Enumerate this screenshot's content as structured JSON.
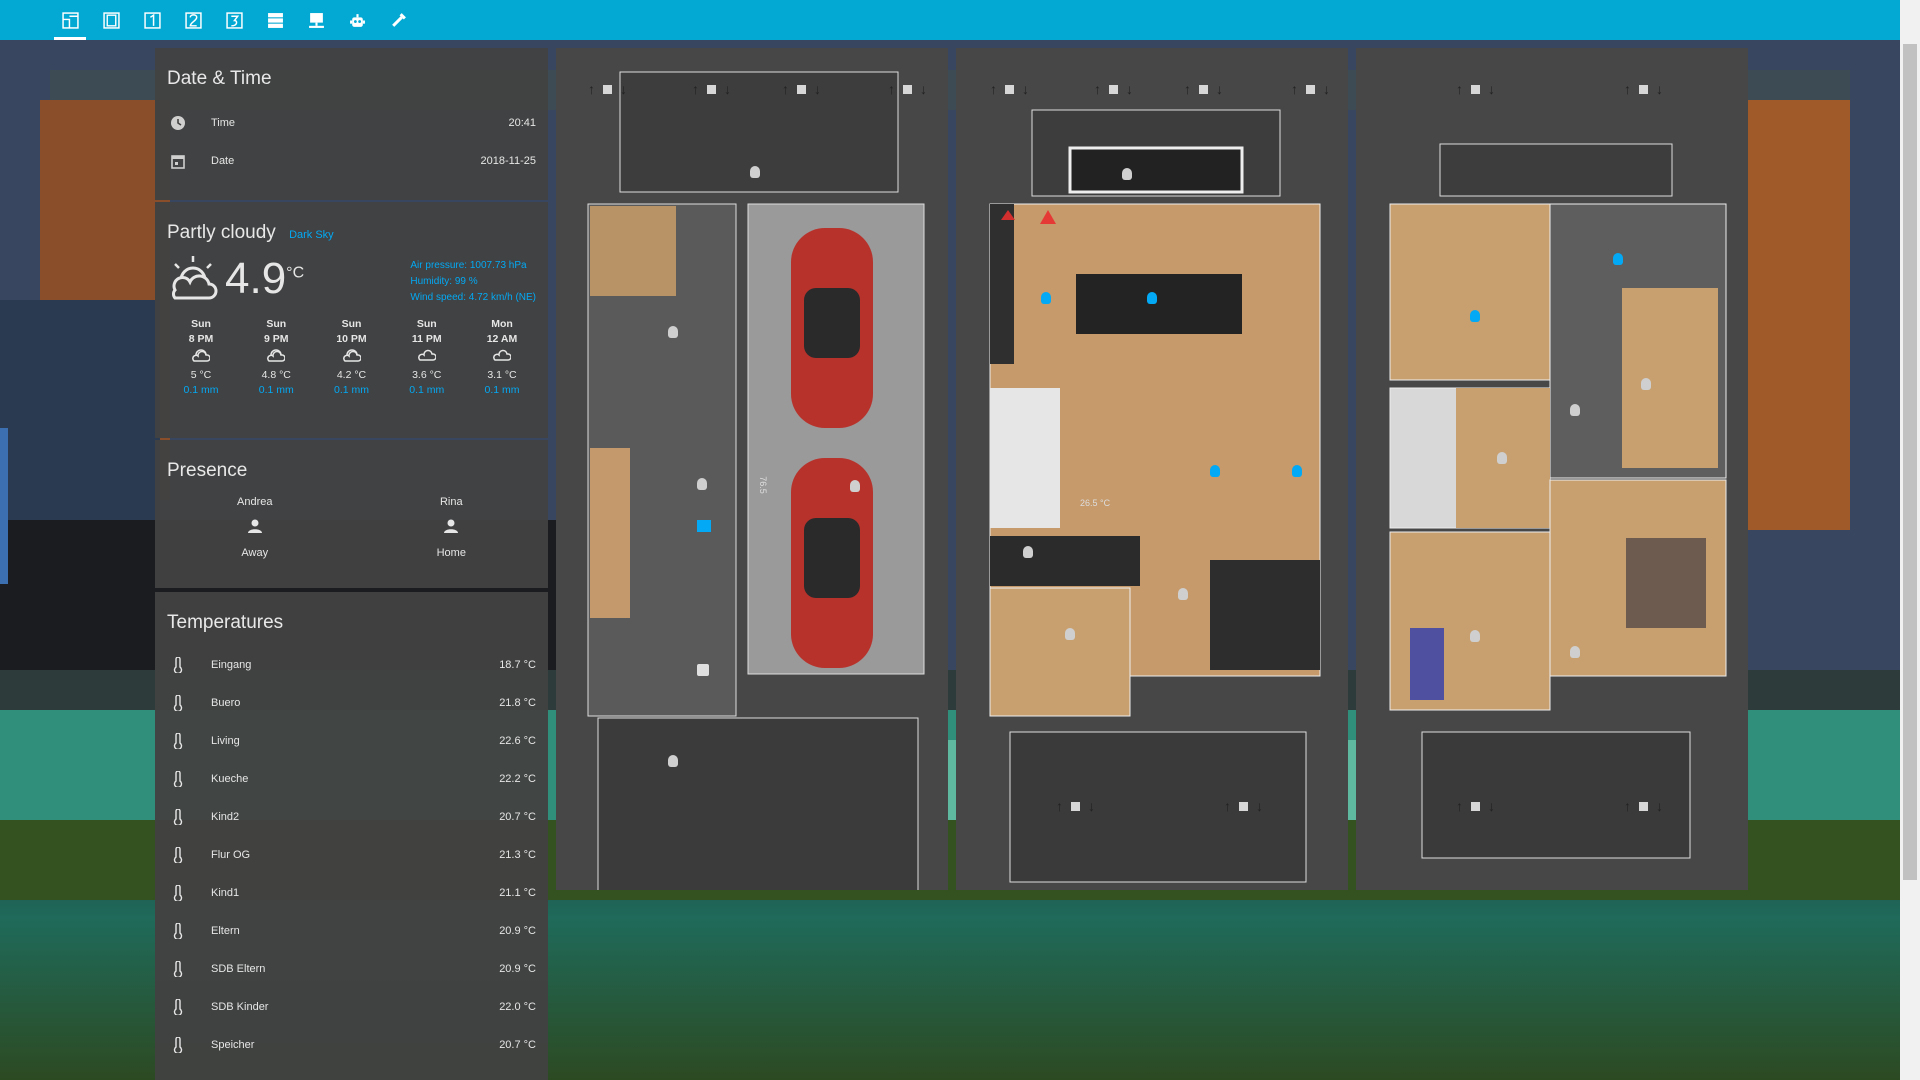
{
  "toolbar": {
    "tabs": [
      {
        "icon": "floorplan-icon",
        "active": true
      },
      {
        "icon": "floor-0-icon"
      },
      {
        "icon": "floor-1-icon"
      },
      {
        "icon": "floor-2-icon"
      },
      {
        "icon": "floor-3-icon"
      },
      {
        "icon": "server-icon"
      },
      {
        "icon": "monitor-icon"
      },
      {
        "icon": "robot-icon"
      },
      {
        "icon": "tools-icon"
      }
    ],
    "color": "#03a9d3"
  },
  "datetime": {
    "title": "Date & Time",
    "time_label": "Time",
    "time_value": "20:41",
    "date_label": "Date",
    "date_value": "2018-11-25"
  },
  "weather": {
    "title": "Partly cloudy",
    "source": "Dark Sky",
    "temperature": "4.9",
    "unit": "°C",
    "pressure": "Air pressure: 1007.73 hPa",
    "humidity": "Humidity: 99 %",
    "wind": "Wind speed: 4.72 km/h (NE)",
    "forecast": [
      {
        "day": "Sun",
        "time": "8 PM",
        "icon": "partly-cloudy-night-icon",
        "temp": "5 °C",
        "precip": "0.1 mm"
      },
      {
        "day": "Sun",
        "time": "9 PM",
        "icon": "partly-cloudy-night-icon",
        "temp": "4.8 °C",
        "precip": "0.1 mm"
      },
      {
        "day": "Sun",
        "time": "10 PM",
        "icon": "partly-cloudy-night-icon",
        "temp": "4.2 °C",
        "precip": "0.1 mm"
      },
      {
        "day": "Sun",
        "time": "11 PM",
        "icon": "cloudy-icon",
        "temp": "3.6 °C",
        "precip": "0.1 mm"
      },
      {
        "day": "Mon",
        "time": "12 AM",
        "icon": "cloudy-icon",
        "temp": "3.1 °C",
        "precip": "0.1 mm"
      }
    ]
  },
  "presence": {
    "title": "Presence",
    "people": [
      {
        "name": "Andrea",
        "state": "Away"
      },
      {
        "name": "Rina",
        "state": "Home"
      }
    ]
  },
  "temperatures": {
    "title": "Temperatures",
    "items": [
      {
        "name": "Eingang",
        "value": "18.7 °C"
      },
      {
        "name": "Buero",
        "value": "21.8 °C"
      },
      {
        "name": "Living",
        "value": "22.6 °C"
      },
      {
        "name": "Kueche",
        "value": "22.2 °C"
      },
      {
        "name": "Kind2",
        "value": "20.7 °C"
      },
      {
        "name": "Flur OG",
        "value": "21.3 °C"
      },
      {
        "name": "Kind1",
        "value": "21.1 °C"
      },
      {
        "name": "Eltern",
        "value": "20.9 °C"
      },
      {
        "name": "SDB Eltern",
        "value": "20.9 °C"
      },
      {
        "name": "SDB Kinder",
        "value": "22.0 °C"
      },
      {
        "name": "Speicher",
        "value": "20.7 °C"
      }
    ]
  },
  "floorplans": [
    {
      "name": "ground-floor",
      "label": "76.5"
    },
    {
      "name": "first-floor",
      "label": "26.5 °C"
    },
    {
      "name": "upper-floor"
    }
  ],
  "colors": {
    "accent": "#03a9f4",
    "card": "#424242"
  }
}
